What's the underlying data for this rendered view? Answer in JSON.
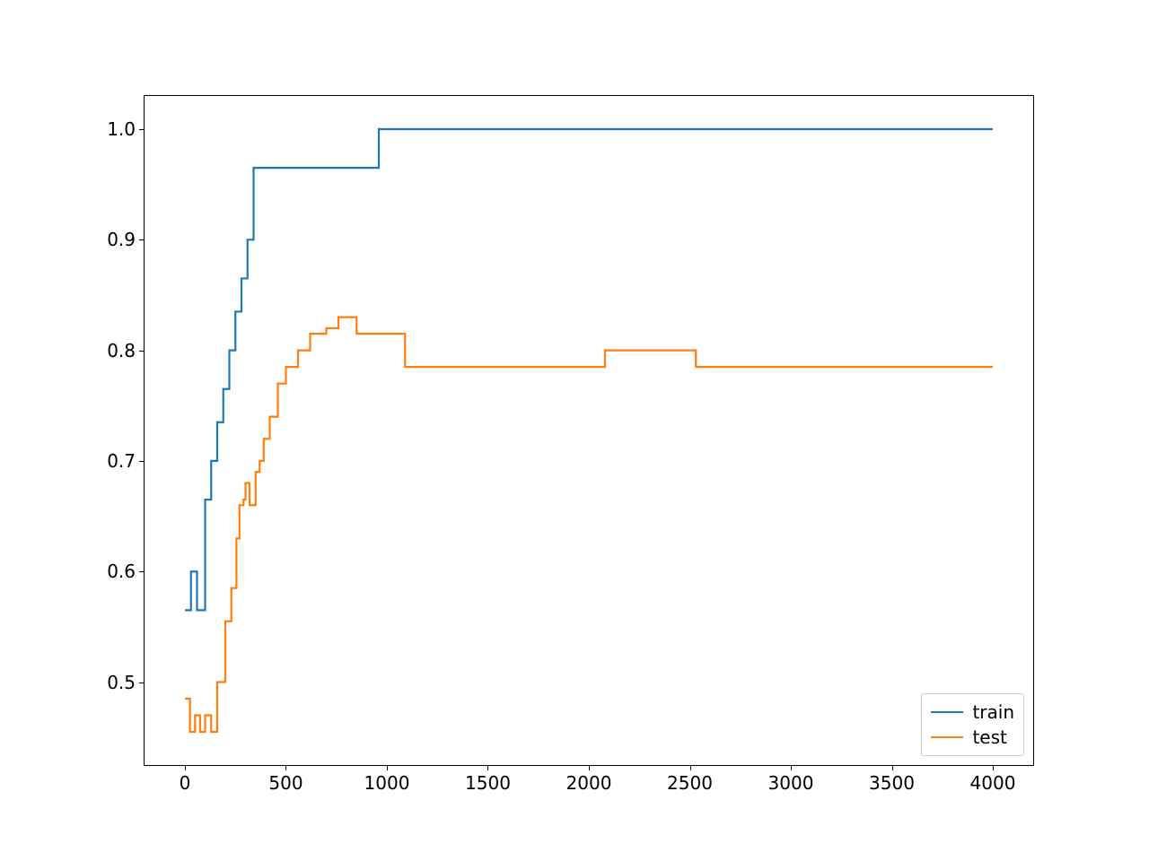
{
  "chart_data": {
    "type": "line",
    "title": "",
    "xlabel": "",
    "ylabel": "",
    "xlim": [
      -200,
      4200
    ],
    "ylim": [
      0.425,
      1.03
    ],
    "xticks": [
      0,
      500,
      1000,
      1500,
      2000,
      2500,
      3000,
      3500,
      4000
    ],
    "yticks": [
      0.5,
      0.6,
      0.7,
      0.8,
      0.9,
      1.0
    ],
    "legend_position": "lower right",
    "series": [
      {
        "name": "train",
        "color": "#1f77b4",
        "x": [
          0,
          30,
          30,
          60,
          60,
          100,
          100,
          130,
          130,
          160,
          160,
          190,
          190,
          220,
          220,
          250,
          250,
          280,
          280,
          310,
          310,
          340,
          340,
          960,
          960,
          4000
        ],
        "y": [
          0.565,
          0.565,
          0.6,
          0.6,
          0.565,
          0.565,
          0.665,
          0.665,
          0.7,
          0.7,
          0.735,
          0.735,
          0.765,
          0.765,
          0.8,
          0.8,
          0.835,
          0.835,
          0.865,
          0.865,
          0.9,
          0.9,
          0.965,
          0.965,
          1.0,
          1.0
        ]
      },
      {
        "name": "test",
        "color": "#ff7f0e",
        "x": [
          0,
          25,
          25,
          50,
          50,
          75,
          75,
          100,
          100,
          130,
          130,
          160,
          160,
          200,
          200,
          230,
          230,
          255,
          255,
          270,
          270,
          290,
          290,
          300,
          300,
          320,
          320,
          350,
          350,
          370,
          370,
          390,
          390,
          420,
          420,
          460,
          460,
          500,
          500,
          560,
          560,
          620,
          620,
          700,
          700,
          760,
          760,
          850,
          850,
          930,
          930,
          1090,
          1090,
          1240,
          1240,
          2080,
          2080,
          2530,
          2530,
          4000
        ],
        "y": [
          0.485,
          0.485,
          0.455,
          0.455,
          0.47,
          0.47,
          0.455,
          0.455,
          0.47,
          0.47,
          0.455,
          0.455,
          0.5,
          0.5,
          0.555,
          0.555,
          0.585,
          0.585,
          0.63,
          0.63,
          0.66,
          0.66,
          0.665,
          0.665,
          0.68,
          0.68,
          0.66,
          0.66,
          0.69,
          0.69,
          0.7,
          0.7,
          0.72,
          0.72,
          0.74,
          0.74,
          0.77,
          0.77,
          0.785,
          0.785,
          0.8,
          0.8,
          0.815,
          0.815,
          0.82,
          0.82,
          0.83,
          0.83,
          0.815,
          0.815,
          0.815,
          0.815,
          0.785,
          0.785,
          0.785,
          0.785,
          0.8,
          0.8,
          0.785,
          0.785
        ]
      }
    ]
  },
  "legend": {
    "items": [
      {
        "label": "train"
      },
      {
        "label": "test"
      }
    ]
  },
  "xtick_labels": [
    "0",
    "500",
    "1000",
    "1500",
    "2000",
    "2500",
    "3000",
    "3500",
    "4000"
  ],
  "ytick_labels": [
    "0.5",
    "0.6",
    "0.7",
    "0.8",
    "0.9",
    "1.0"
  ]
}
